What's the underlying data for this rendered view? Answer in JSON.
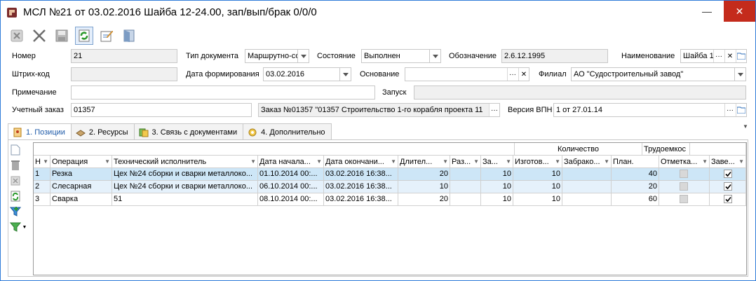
{
  "window": {
    "title": "МСЛ №21 от 03.02.2016 Шайба 12-24.00, зап/вып/брак 0/0/0",
    "minimize": "—",
    "close": "✕"
  },
  "toolbar": {
    "buttons": [
      "cancel-icon",
      "delete-icon",
      "save-icon",
      "refresh-icon",
      "edit-icon",
      "exit-icon"
    ]
  },
  "form": {
    "nomer_label": "Номер",
    "nomer_value": "21",
    "doc_type_label": "Тип документа",
    "doc_type_value": "Маршрутно-со",
    "state_label": "Состояние",
    "state_value": "Выполнен",
    "designation_label": "Обозначение",
    "designation_value": "2.6.12.1995",
    "name_label": "Наименование",
    "name_value": "Шайба 1",
    "barcode_label": "Штрих-код",
    "barcode_value": "",
    "form_date_label": "Дата формирования",
    "form_date_value": "03.02.2016",
    "basis_label": "Основание",
    "basis_value": "",
    "branch_label": "Филиал",
    "branch_value": "АО \"Судостроительный завод\"",
    "note_label": "Примечание",
    "note_value": "",
    "launch_label": "Запуск",
    "launch_value": "",
    "order_label": "Учетный заказ",
    "order_value": "01357",
    "order_desc_value": "Заказ №01357 \"01357 Строительство 1-го корабля проекта 11",
    "vpn_label": "Версия ВПН",
    "vpn_value": "1 от 27.01.14",
    "ellipsis": "···",
    "clear": "✕"
  },
  "tabs": [
    {
      "label": "1. Позиции",
      "active": true
    },
    {
      "label": "2. Ресурсы",
      "active": false
    },
    {
      "label": "3. Связь с документами",
      "active": false
    },
    {
      "label": "4. Дополнительно",
      "active": false
    }
  ],
  "grid": {
    "group_headers": {
      "quantity": "Количество",
      "labor": "Трудоемкос"
    },
    "columns": [
      "Н",
      "Операция",
      "Технический исполнитель",
      "Дата начала...",
      "Дата окончани...",
      "Длител...",
      "Раз...",
      "За...",
      "Изготов...",
      "Забрако...",
      "План.",
      "Отметка...",
      "Заве..."
    ],
    "rows": [
      {
        "n": "1",
        "operation": "Резка",
        "executor": "Цех №24 сборки и сварки металлоко...",
        "start": "01.10.2014 00:...",
        "end": "03.02.2016 16:38...",
        "duration": "20",
        "raz": "",
        "za": "10",
        "made": "10",
        "rejected": "",
        "plan": "40",
        "mark": false,
        "done": true
      },
      {
        "n": "2",
        "operation": "Слесарная",
        "executor": "Цех №24 сборки и сварки металлоко...",
        "start": "06.10.2014 00:...",
        "end": "03.02.2016 16:38...",
        "duration": "10",
        "raz": "",
        "za": "10",
        "made": "10",
        "rejected": "",
        "plan": "20",
        "mark": false,
        "done": true
      },
      {
        "n": "3",
        "operation": "Сварка",
        "executor": "51",
        "start": "08.10.2014 00:...",
        "end": "03.02.2016 16:38...",
        "duration": "20",
        "raz": "",
        "za": "10",
        "made": "10",
        "rejected": "",
        "plan": "60",
        "mark": false,
        "done": true
      }
    ]
  },
  "colors": {
    "accent": "#1e5aa8",
    "selection": "#cde6f7",
    "close_red": "#c42b1c"
  }
}
